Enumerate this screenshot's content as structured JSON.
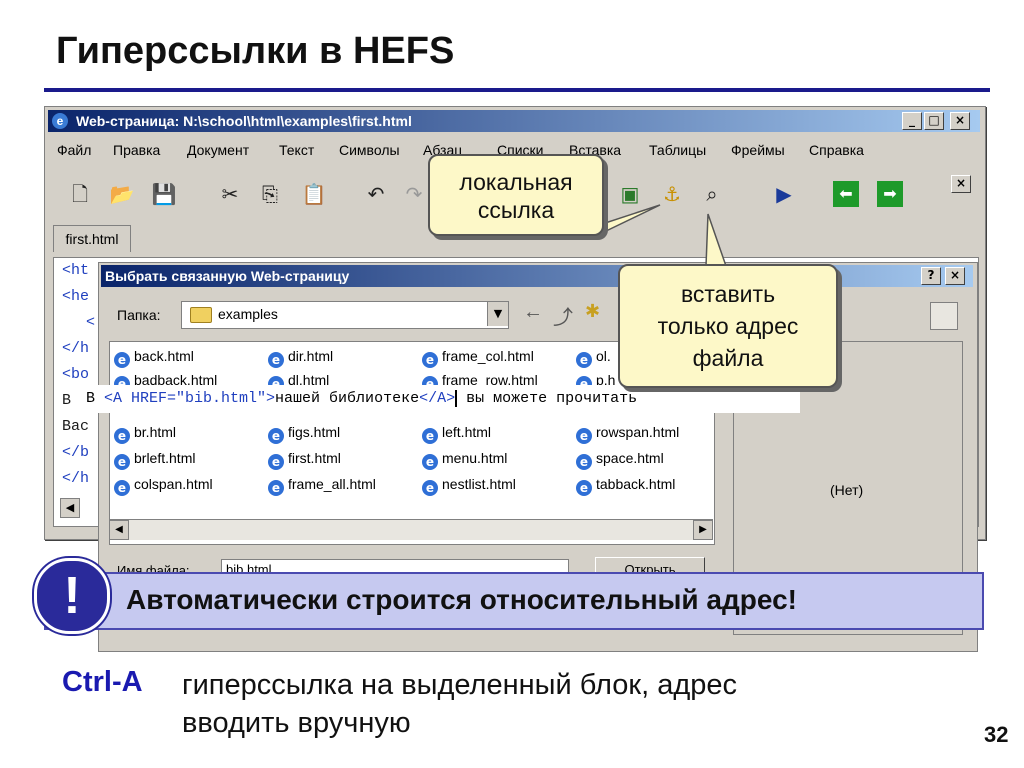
{
  "slide": {
    "title": "Гиперссылки в HEFS",
    "page_number": "32"
  },
  "app": {
    "title": "Web-страница: N:\\school\\html\\examples\\first.html",
    "menu": [
      "Файл",
      "Правка",
      "Документ",
      "Текст",
      "Символы",
      "Абзац",
      "Списки",
      "Вставка",
      "Таблицы",
      "Фреймы",
      "Справка"
    ],
    "doc_tab": "first.html",
    "code_fragments": [
      "<ht",
      "<he",
      "<",
      "</h",
      "<bo",
      "В",
      "Вас",
      "</b",
      "</h"
    ]
  },
  "dialog": {
    "title": "Выбрать связанную Web-страницу",
    "folder_label": "Папка:",
    "folder_value": "examples",
    "files": [
      [
        "back.html",
        "dir.html",
        "frame_col.html",
        "ol."
      ],
      [
        "badback.html",
        "dl.html",
        "frame_row.html",
        "p.h"
      ],
      [
        "br.html",
        "figs.html",
        "left.html",
        "rowspan.html"
      ],
      [
        "brleft.html",
        "first.html",
        "menu.html",
        "space.html"
      ],
      [
        "colspan.html",
        "frame_all.html",
        "nestlist.html",
        "tabback.html"
      ]
    ],
    "preview_text": "(Нет)",
    "filename_label": "Имя файла:",
    "filename_value": "bib.html",
    "ok_label": "Открыть"
  },
  "code_strip": {
    "prefix": "В ",
    "open_tag": "<A HREF=\"bib.html\">",
    "link_text": "нашей библиотеке",
    "close_tag": "</A>",
    "suffix": " вы можете прочитать"
  },
  "callouts": {
    "local_link": [
      "локальная",
      "ссылка"
    ],
    "insert_address": [
      "вставить",
      "только адрес",
      "файла"
    ]
  },
  "alert": {
    "icon": "!",
    "text": "Автоматически строится относительный адрес!"
  },
  "shortcut": {
    "key": "Ctrl-A",
    "description": [
      "гиперссылка на выделенный блок, адрес",
      "вводить вручную"
    ]
  }
}
